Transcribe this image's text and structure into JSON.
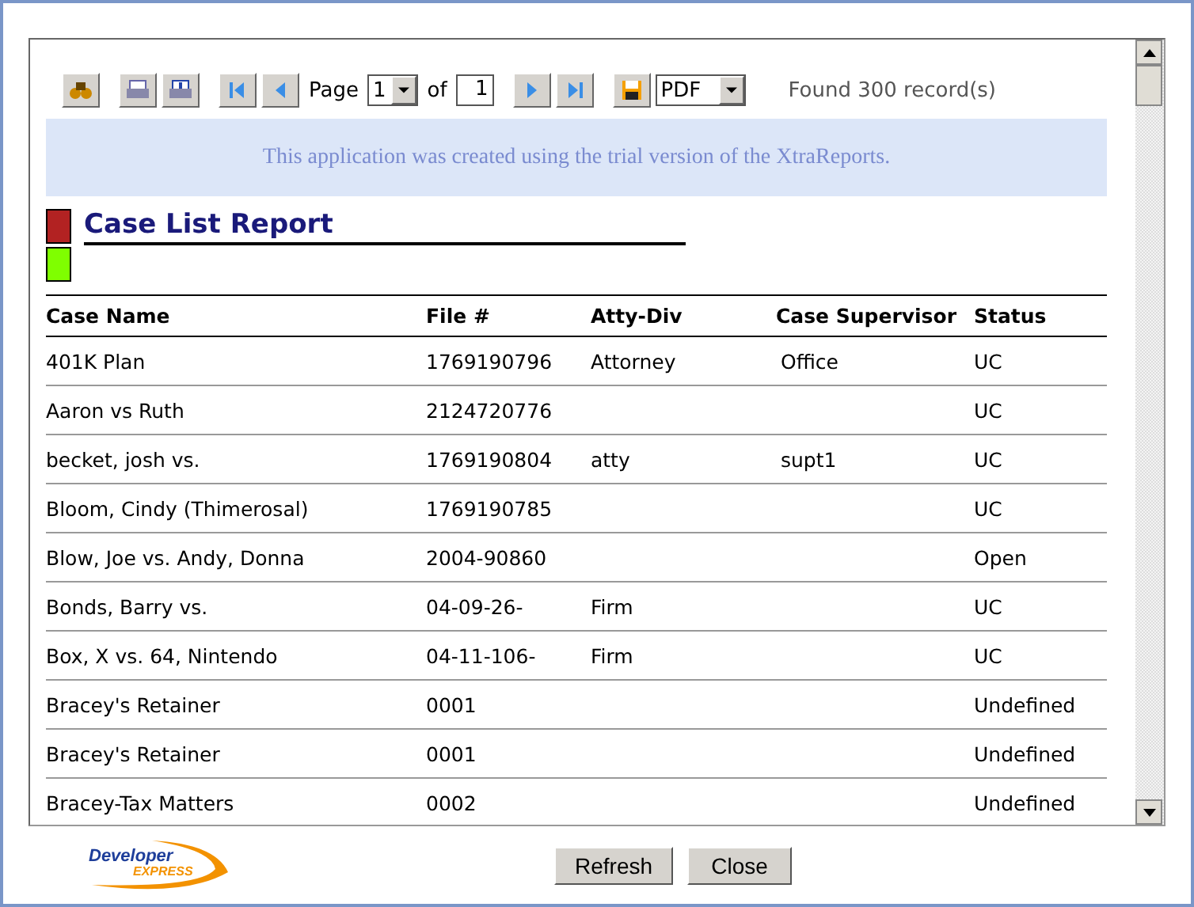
{
  "toolbar": {
    "page_label": "Page",
    "page_value": "1",
    "of_label": "of",
    "page_count": "1",
    "format": "PDF",
    "found": "Found 300 record(s)"
  },
  "banner": "This application was created using the trial version of the XtraReports.",
  "report": {
    "title": "Case List Report",
    "markers": [
      {
        "color": "#b22222"
      },
      {
        "color": "#7fff00"
      }
    ],
    "columns": [
      "Case Name",
      "File #",
      "Atty-Div",
      "Case Supervisor",
      "Status"
    ],
    "rows": [
      [
        "401K Plan",
        "1769190796",
        "Attorney",
        "Office",
        "UC"
      ],
      [
        "Aaron vs Ruth",
        "2124720776",
        "",
        "",
        "UC"
      ],
      [
        "becket, josh vs.",
        "1769190804",
        "atty",
        "supt1",
        "UC"
      ],
      [
        "Bloom, Cindy (Thimerosal)",
        "1769190785",
        "",
        "",
        "UC"
      ],
      [
        "Blow, Joe vs. Andy, Donna",
        "2004-90860",
        "",
        "",
        "Open"
      ],
      [
        "Bonds, Barry vs.",
        "04-09-26-",
        "Firm",
        "",
        "UC"
      ],
      [
        "Box, X vs. 64, Nintendo",
        "04-11-106-",
        "Firm",
        "",
        "UC"
      ],
      [
        "Bracey's Retainer",
        "0001",
        "",
        "",
        "Undefined"
      ],
      [
        "Bracey's Retainer",
        "0001",
        "",
        "",
        "Undefined"
      ],
      [
        "Bracey-Tax Matters",
        "0002",
        "",
        "",
        "Undefined"
      ]
    ]
  },
  "logo": {
    "line1": "Developer",
    "line2": "EXPRESS"
  },
  "buttons": [
    "Refresh",
    "Close"
  ]
}
